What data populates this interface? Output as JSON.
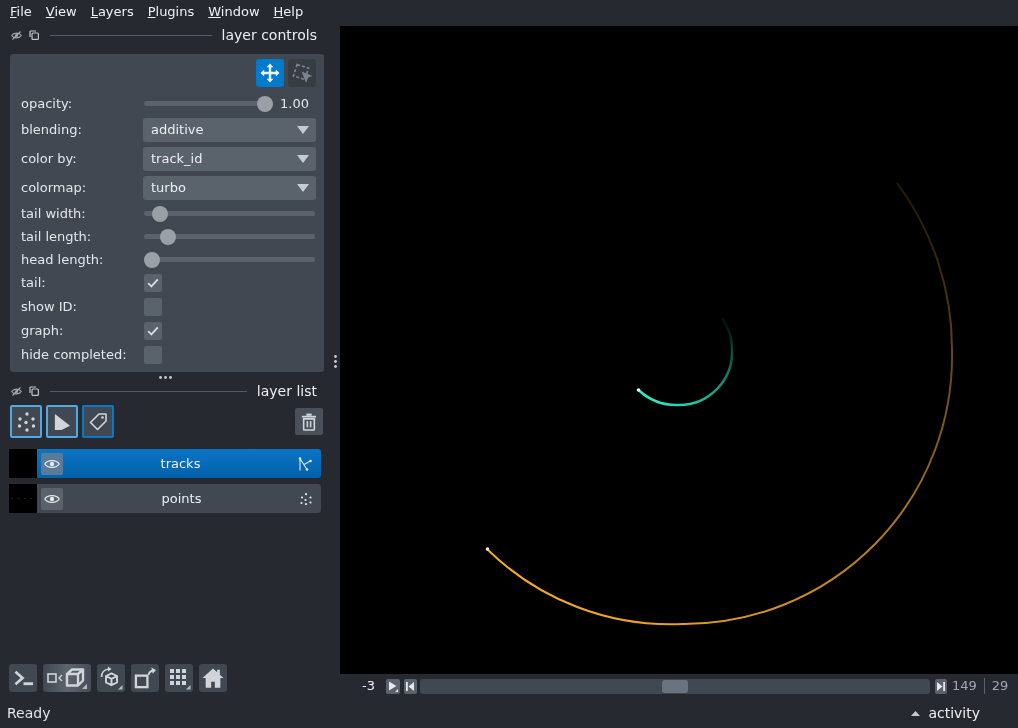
{
  "menu": [
    "File",
    "View",
    "Layers",
    "Plugins",
    "Window",
    "Help"
  ],
  "layer_controls": {
    "title": "layer controls",
    "mode_buttons": [
      {
        "kind": "pan_zoom",
        "selected": true
      },
      {
        "kind": "transform",
        "selected": false
      }
    ],
    "controls": [
      {
        "kind": "slider",
        "label": "opacity:",
        "level": 1,
        "reading": "1.00"
      },
      {
        "kind": "dropdown",
        "label": "blending:",
        "value": "additive"
      },
      {
        "kind": "dropdown",
        "label": "color by:",
        "value": "track_id"
      },
      {
        "kind": "dropdown",
        "label": "colormap:",
        "value": "turbo"
      },
      {
        "kind": "slider",
        "label": "tail width:",
        "level": 0.05
      },
      {
        "kind": "slider",
        "label": "tail length:",
        "level": 0.1
      },
      {
        "kind": "slider",
        "label": "head length:",
        "level": 0
      },
      {
        "kind": "checkbox",
        "label": "tail:",
        "checked": true
      },
      {
        "kind": "checkbox",
        "label": "show ID:",
        "checked": false
      },
      {
        "kind": "checkbox",
        "label": "graph:",
        "checked": true
      },
      {
        "kind": "checkbox",
        "label": "hide completed:",
        "checked": false
      }
    ]
  },
  "layer_list": {
    "title": "layer list",
    "layers": [
      {
        "name": "tracks",
        "kind": "tracks",
        "selected": true,
        "visible": true
      },
      {
        "name": "points",
        "kind": "points",
        "selected": false,
        "visible": true
      }
    ]
  },
  "dims": {
    "axis_label": "-3",
    "level": 0.5,
    "current": "149",
    "maximum": "29"
  },
  "status_bar": {
    "message": "Ready",
    "activity": "activity"
  }
}
